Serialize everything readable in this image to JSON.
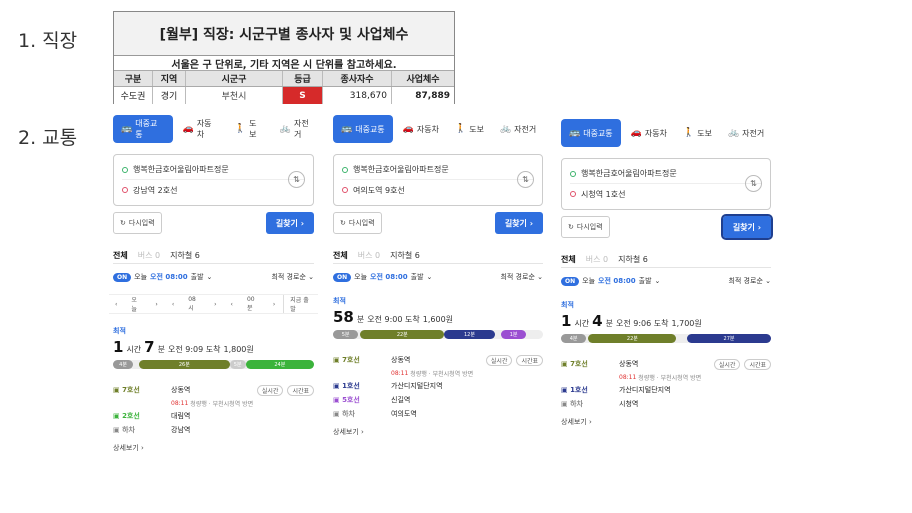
{
  "sections": {
    "work": "1. 직장",
    "traffic": "2. 교통"
  },
  "table": {
    "title": "[월부] 직장: 시군구별 종사자 및 사업체수",
    "note": "서울은 구 단위로, 기타 지역은 시 단위를 참고하세요.",
    "headers": [
      "구분",
      "지역",
      "시군구",
      "등급",
      "종사자수",
      "사업체수"
    ],
    "row": [
      "수도권",
      "경기",
      "부천시",
      "S",
      "318,670",
      "87,889"
    ],
    "grade_color": "#d62a2a"
  },
  "modes": [
    "대중교통",
    "자동차",
    "도보",
    "자전거"
  ],
  "common": {
    "reset": "다시입력",
    "find": "길찾기",
    "tab_all": "전체",
    "tab_bus": "버스 0",
    "tab_subway": "지하철 6",
    "on": "ON",
    "today": "오늘",
    "dep_time": "오전 08:00",
    "dep_suffix": "출발",
    "sort": "최적 경로순",
    "best": "최적",
    "detail": "상세보기",
    "arrival_label": "도착"
  },
  "panel1": {
    "origin": "행복한금호어울림아파트정문",
    "dest": "강남역 2호선",
    "timesel": [
      "오늘",
      "08시",
      "00분",
      "지금 출발"
    ],
    "dur_h": "1",
    "dur_h_unit": "시간",
    "dur_m": "7",
    "dur_m_unit": "분",
    "arrival": "오전 9:09 도착",
    "fare": "1,800원",
    "segments": [
      {
        "label": "4분",
        "color": "#999999",
        "start": 0.0,
        "end": 0.1
      },
      {
        "label": "26분",
        "color": "#6f7f2a",
        "start": 0.13,
        "end": 0.58
      },
      {
        "label": "5분",
        "color": "#cccccc",
        "start": 0.58,
        "end": 0.66
      },
      {
        "label": "24분",
        "color": "#3bb33b",
        "start": 0.66,
        "end": 1.0
      }
    ],
    "legs": [
      {
        "line": "7호선",
        "color": "#6f7f2a",
        "stn": "상동역",
        "p1": "실시간",
        "p2": "시간표"
      },
      {
        "line": "2호선",
        "color": "#3bb33b",
        "stn": "대림역"
      },
      {
        "line": "하차",
        "color": "#888888",
        "stn": "강남역"
      }
    ],
    "sub_time": "08:11",
    "sub_text": "청량행 · 부천시청역 방면"
  },
  "panel2": {
    "origin": "행복한금호어울림아파트정문",
    "dest": "여의도역 9호선",
    "dur_m": "58",
    "dur_m_unit": "분",
    "arrival": "오전 9:00 도착",
    "fare": "1,600원",
    "segments": [
      {
        "label": "5분",
        "color": "#999999",
        "start": 0.0,
        "end": 0.12
      },
      {
        "label": "22분",
        "color": "#6f7f2a",
        "start": 0.13,
        "end": 0.53
      },
      {
        "label": "12분",
        "color": "#2b3a8f",
        "start": 0.53,
        "end": 0.77
      },
      {
        "label": "1분",
        "color": "#9b4fd1",
        "start": 0.8,
        "end": 0.92
      }
    ],
    "legs": [
      {
        "line": "7호선",
        "color": "#6f7f2a",
        "stn": "상동역",
        "p1": "실시간",
        "p2": "시간표"
      },
      {
        "line": "1호선",
        "color": "#2b3a8f",
        "stn": "가산디지털단지역"
      },
      {
        "line": "5호선",
        "color": "#9b4fd1",
        "stn": "신길역"
      },
      {
        "line": "하차",
        "color": "#888888",
        "stn": "여의도역"
      }
    ],
    "sub_time": "08:11",
    "sub_text": "청량행 · 부천시청역 방면"
  },
  "panel3": {
    "origin": "행복한금호어울림아파트정문",
    "dest": "시청역 1호선",
    "dur_h": "1",
    "dur_h_unit": "시간",
    "dur_m": "4",
    "dur_m_unit": "분",
    "arrival": "오전 9:06 도착",
    "fare": "1,700원",
    "segments": [
      {
        "label": "4분",
        "color": "#999999",
        "start": 0.0,
        "end": 0.12
      },
      {
        "label": "22분",
        "color": "#6f7f2a",
        "start": 0.13,
        "end": 0.55
      },
      {
        "label": "27분",
        "color": "#2b3a8f",
        "start": 0.6,
        "end": 1.0
      }
    ],
    "legs": [
      {
        "line": "7호선",
        "color": "#6f7f2a",
        "stn": "상동역",
        "p1": "실시간",
        "p2": "시간표"
      },
      {
        "line": "1호선",
        "color": "#2b3a8f",
        "stn": "가산디지털단지역"
      },
      {
        "line": "하차",
        "color": "#888888",
        "stn": "시청역"
      }
    ],
    "sub_time": "08:11",
    "sub_text": "청량행 · 부천시청역 방면"
  },
  "icons": {
    "bus": "bus-icon",
    "car": "car-icon",
    "walk": "walk-icon",
    "bike": "bike-icon",
    "swap": "swap-icon",
    "reset": "refresh-icon",
    "chevron": "chevron-right-icon"
  }
}
